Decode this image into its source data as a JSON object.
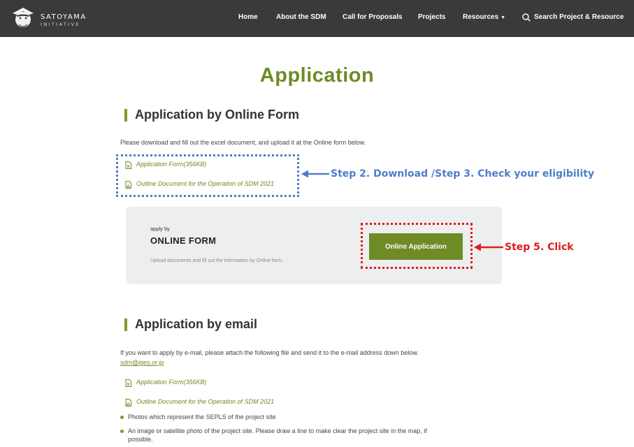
{
  "header": {
    "logo_line1": "SATOYAMA",
    "logo_line2": "INITIATIVE",
    "nav": {
      "home": "Home",
      "about": "About the SDM",
      "call": "Call for Proposals",
      "projects": "Projects",
      "resources": "Resources",
      "resources_caret": "▼"
    },
    "search_label": "Search Project & Resource"
  },
  "page_title": "Application",
  "online_section": {
    "title": "Application by Online Form",
    "intro": "Please download and fill out the excel document, and upload it at the Online form below.",
    "links": {
      "form": "Application Form(356KB)",
      "outline": "Outline Document for the Operation of SDM 2021"
    },
    "card": {
      "kicker": "apply by",
      "title": "ONLINE FORM",
      "desc": "Upload documents and fill out the information by Online form.",
      "button": "Online Application"
    }
  },
  "annotations": {
    "step2": "Step 2. Download /Step 3. Check your eligibility",
    "step5": "Step 5. Click",
    "blue": "#4e7ec8",
    "red": "#e41a1a"
  },
  "email_section": {
    "title": "Application by email",
    "intro": "If you want to apply by e-mail, please attach the following file and send it to the e-mail address down below.",
    "email": "sdm@iges.or.jp",
    "links": {
      "form": "Application Form(356KB)",
      "outline": "Outline Document for the Operation of SDM 2021"
    },
    "bullets": {
      "photos": "Photos which represent the SEPLS of the project site",
      "map_line1": "An image or satellite photo of the project site. Please draw a line to make clear the project site in the map, if",
      "map_line2": "possible."
    }
  },
  "colors": {
    "brand_green": "#6e8b25",
    "header_bg": "#3a3a3d",
    "card_bg": "#eceef0"
  }
}
